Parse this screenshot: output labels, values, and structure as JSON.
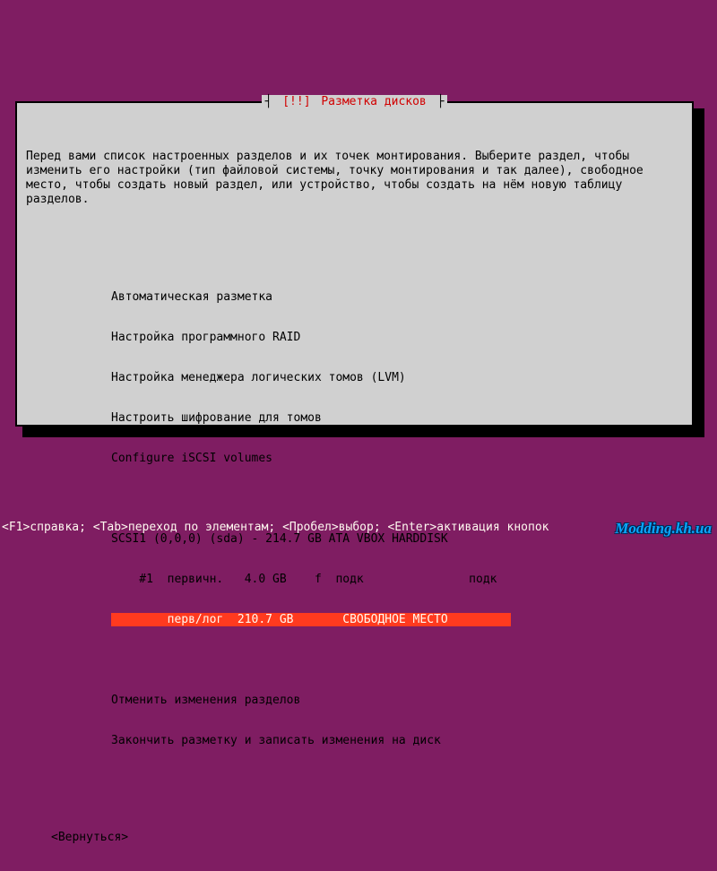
{
  "dialog": {
    "title_left": "┤ ",
    "title_alert": "[!!] ",
    "title_text": "Разметка дисков",
    "title_right": " ├",
    "instructions": "Перед вами список настроенных разделов и их точек монтирования. Выберите раздел, чтобы изменить его настройки (тип файловой системы, точку монтирования и так далее), свободное место, чтобы создать новый раздел, или устройство, чтобы создать на нём новую таблицу разделов."
  },
  "menu": {
    "auto": "Автоматическая разметка",
    "raid": "Настройка программного RAID",
    "lvm": "Настройка менеджера логических томов (LVM)",
    "crypto": "Настроить шифрование для томов",
    "iscsi": "Configure iSCSI volumes",
    "disk": "SCSI1 (0,0,0) (sda) - 214.7 GB ATA VBOX HARDDISK",
    "part1": "    #1  первичн.   4.0 GB    f  подк               подк",
    "free": "        перв/лог  210.7 GB       СВОБОДНОЕ МЕСТО         ",
    "undo": "Отменить изменения разделов",
    "finish": "Закончить разметку и записать изменения на диск"
  },
  "back": "<Вернуться>",
  "footer": "<F1>справка; <Tab>переход по элементам; <Пробел>выбор; <Enter>активация кнопок",
  "watermark": "Modding.kh.ua"
}
